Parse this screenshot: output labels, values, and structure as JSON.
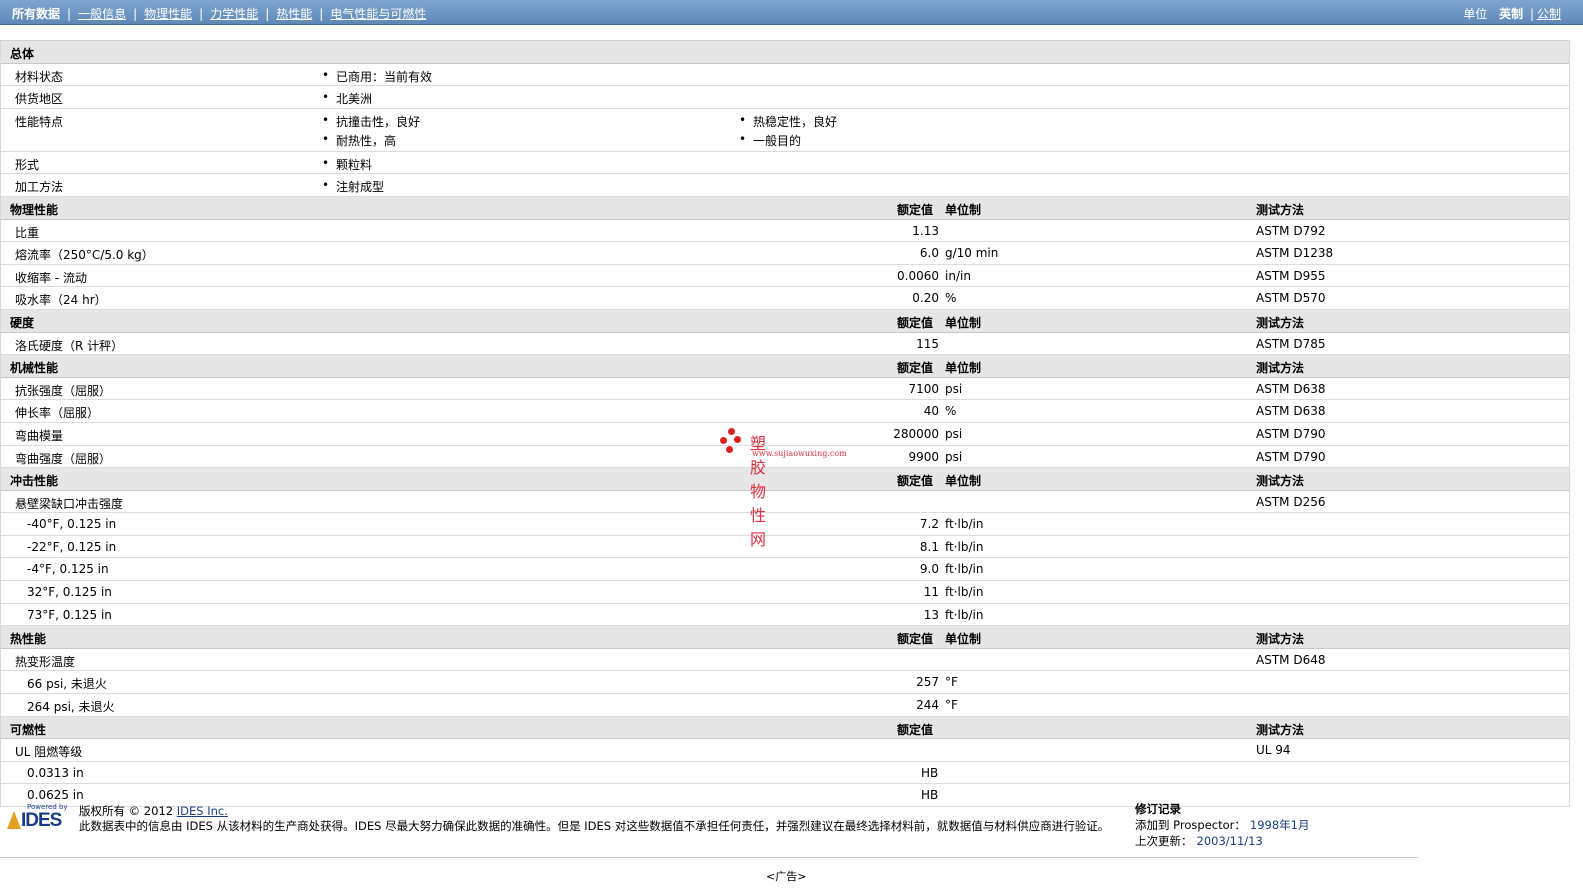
{
  "nav": {
    "items": [
      "所有数据",
      "一般信息",
      "物理性能",
      "力学性能",
      "热性能",
      "电气性能与可燃性"
    ],
    "units_label": "单位",
    "unit_selected": "英制",
    "unit_alt": "公制"
  },
  "headers": {
    "rated": "额定值",
    "unit": "单位制",
    "method": "测试方法"
  },
  "general": {
    "title": "总体",
    "status_label": "材料状态",
    "status_value": "已商用：当前有效",
    "region_label": "供货地区",
    "region_value": "北美洲",
    "features_label": "性能特点",
    "features": [
      "抗撞击性，良好",
      "热稳定性，良好",
      "耐热性，高",
      "一般目的"
    ],
    "form_label": "形式",
    "form_value": "颗粒料",
    "process_label": "加工方法",
    "process_value": "注射成型"
  },
  "physical": {
    "title": "物理性能",
    "rows": [
      {
        "label": "比重",
        "value": "1.13",
        "unit": "",
        "method": "ASTM D792"
      },
      {
        "label": "熔流率（250°C/5.0 kg）",
        "value": "6.0",
        "unit": "g/10 min",
        "method": "ASTM D1238"
      },
      {
        "label": "收缩率 - 流动",
        "value": "0.0060",
        "unit": "in/in",
        "method": "ASTM D955"
      },
      {
        "label": "吸水率（24 hr）",
        "value": "0.20",
        "unit": "%",
        "method": "ASTM D570"
      }
    ]
  },
  "hardness": {
    "title": "硬度",
    "rows": [
      {
        "label": "洛氏硬度（R 计秤）",
        "value": "115",
        "unit": "",
        "method": "ASTM D785"
      }
    ]
  },
  "mechanical": {
    "title": "机械性能",
    "rows": [
      {
        "label": "抗张强度（屈服）",
        "value": "7100",
        "unit": "psi",
        "method": "ASTM D638"
      },
      {
        "label": "伸长率（屈服）",
        "value": "40",
        "unit": "%",
        "method": "ASTM D638"
      },
      {
        "label": "弯曲模量",
        "value": "280000",
        "unit": "psi",
        "method": "ASTM D790"
      },
      {
        "label": "弯曲强度（屈服）",
        "value": "9900",
        "unit": "psi",
        "method": "ASTM D790"
      }
    ]
  },
  "impact": {
    "title": "冲击性能",
    "group_label": "悬壁梁缺口冲击强度",
    "group_method": "ASTM D256",
    "rows": [
      {
        "label": "-40°F, 0.125 in",
        "value": "7.2",
        "unit": "ft·lb/in"
      },
      {
        "label": "-22°F, 0.125 in",
        "value": "8.1",
        "unit": "ft·lb/in"
      },
      {
        "label": "-4°F, 0.125 in",
        "value": "9.0",
        "unit": "ft·lb/in"
      },
      {
        "label": "32°F, 0.125 in",
        "value": "11",
        "unit": "ft·lb/in"
      },
      {
        "label": "73°F, 0.125 in",
        "value": "13",
        "unit": "ft·lb/in"
      }
    ]
  },
  "thermal": {
    "title": "热性能",
    "group_label": "热变形温度",
    "group_method": "ASTM D648",
    "rows": [
      {
        "label": "66 psi, 未退火",
        "value": "257",
        "unit": "°F"
      },
      {
        "label": "264 psi, 未退火",
        "value": "244",
        "unit": "°F"
      }
    ]
  },
  "flammability": {
    "title": "可燃性",
    "group_label": "UL 阻燃等级",
    "group_method": "UL 94",
    "rows": [
      {
        "label": "0.0313 in",
        "value": "HB"
      },
      {
        "label": "0.0625 in",
        "value": "HB"
      }
    ]
  },
  "watermark": {
    "title": "塑胶物性网",
    "url": "www.sujiaowuxing.com"
  },
  "footer": {
    "logo_powered": "Powered by",
    "logo_text": "IDES",
    "copyright": "版权所有 © 2012",
    "company_link": "IDES Inc.",
    "disclaimer": "此数据表中的信息由 IDES 从该材料的生产商处获得。IDES 尽最大努力确保此数据的准确性。但是 IDES 对这些数据值不承担任何责任，并强烈建议在最终选择材料前，就数据值与材料供应商进行验证。",
    "revision_title": "修订记录",
    "added_label": "添加到 Prospector：",
    "added_value": "1998年1月",
    "updated_label": "上次更新：",
    "updated_value": "2003/11/13",
    "ad": "<广告>"
  },
  "colors": {
    "nav_bar": "#6f98c4",
    "section_bg": "#e6e6e6",
    "link": "#1a3b8a",
    "watermark": "#e03040"
  }
}
